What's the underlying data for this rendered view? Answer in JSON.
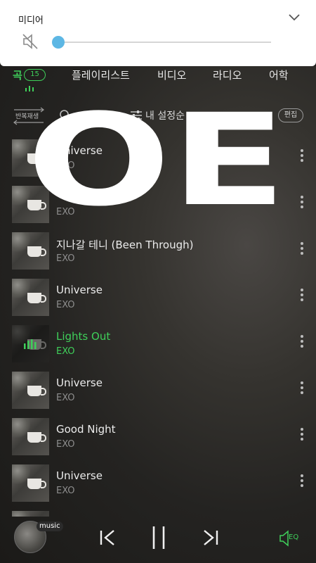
{
  "media_panel": {
    "title": "미디어"
  },
  "tabs": {
    "song": "곡",
    "song_count": "15",
    "playlist": "플레이리스트",
    "video": "비디오",
    "radio": "라디오",
    "language": "어학"
  },
  "toolbar": {
    "repeat": "반복재생",
    "sort": "내 설정순",
    "edit": "편집"
  },
  "songs": [
    {
      "title": "Universe",
      "artist": "EXO",
      "active": false
    },
    {
      "title": "",
      "artist": "EXO",
      "active": false
    },
    {
      "title": "지나갈 테니 (Been Through)",
      "artist": "EXO",
      "active": false
    },
    {
      "title": "Universe",
      "artist": "EXO",
      "active": false
    },
    {
      "title": "Lights Out",
      "artist": "EXO",
      "active": true
    },
    {
      "title": "Universe",
      "artist": "EXO",
      "active": false
    },
    {
      "title": "Good Night",
      "artist": "EXO",
      "active": false
    },
    {
      "title": "Universe",
      "artist": "EXO",
      "active": false
    }
  ],
  "watermark": {
    "letters": "OE"
  },
  "player": {
    "badge": "music",
    "eq": "EQ"
  },
  "colors": {
    "accent": "#3fcf5a",
    "slider": "#5db7e4"
  }
}
